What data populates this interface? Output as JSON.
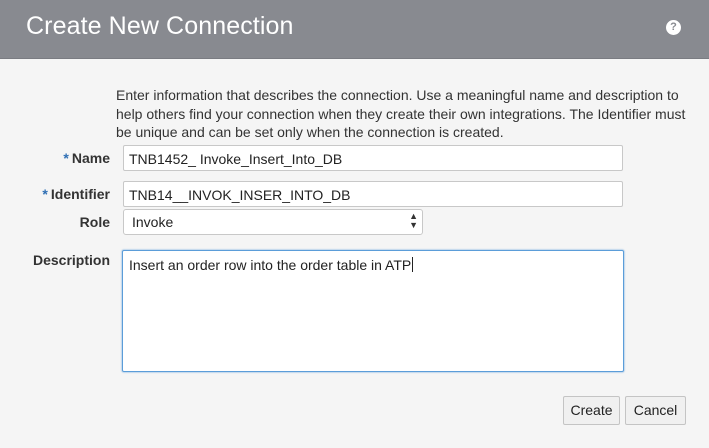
{
  "dialog": {
    "title": "Create New Connection",
    "help_icon": "?"
  },
  "intro_text": "Enter information that describes the connection. Use a meaningful name and description to help others find your connection when they create their own integrations. The Identifier must be unique and can be set only when the connection is created.",
  "fields": {
    "required_marker": "*",
    "name_label": "Name",
    "name_value": "TNB1452_ Invoke_Insert_Into_DB",
    "identifier_label": "Identifier",
    "identifier_value": "TNB14__INVOK_INSER_INTO_DB",
    "role_label": "Role",
    "role_value": "Invoke",
    "description_label": "Description",
    "description_value": "Insert an order row into the order table in ATP"
  },
  "buttons": {
    "create": "Create",
    "cancel": "Cancel"
  },
  "colors": {
    "header_bg": "#888a90",
    "required_marker": "#2f6fb4",
    "focus_border": "#5b9dd9"
  },
  "icons": [
    "help-icon",
    "select-arrows-icon"
  ]
}
